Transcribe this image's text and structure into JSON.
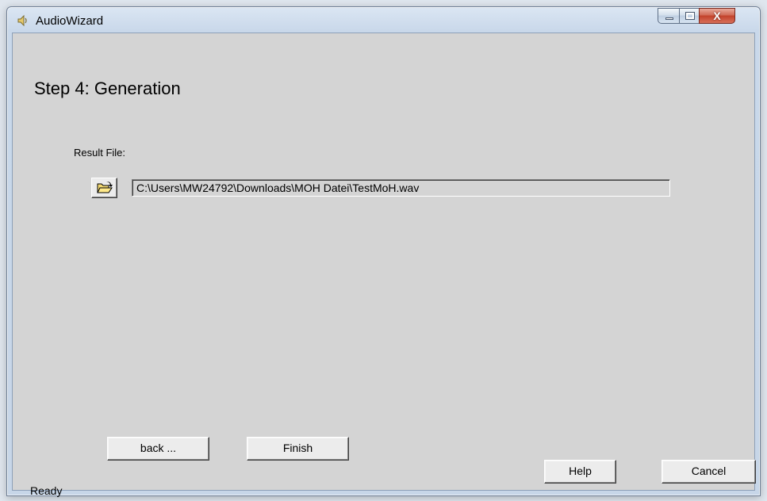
{
  "window": {
    "title": "AudioWizard",
    "icon": "speaker-icon"
  },
  "controls": {
    "minimize": "minimize-icon",
    "maximize": "maximize-icon",
    "close_label": "X"
  },
  "wizard": {
    "step_title": "Step 4: Generation",
    "result_file_label": "Result File:",
    "browse_icon": "open-folder-icon",
    "result_file_path": "C:\\Users\\MW24792\\Downloads\\MOH Datei\\TestMoH.wav"
  },
  "buttons": {
    "back": "back ...",
    "finish": "Finish",
    "help": "Help",
    "cancel": "Cancel"
  },
  "status": {
    "text": "Ready"
  },
  "colors": {
    "dialog_background": "#d4d4d4",
    "close_button": "#c2412a"
  }
}
